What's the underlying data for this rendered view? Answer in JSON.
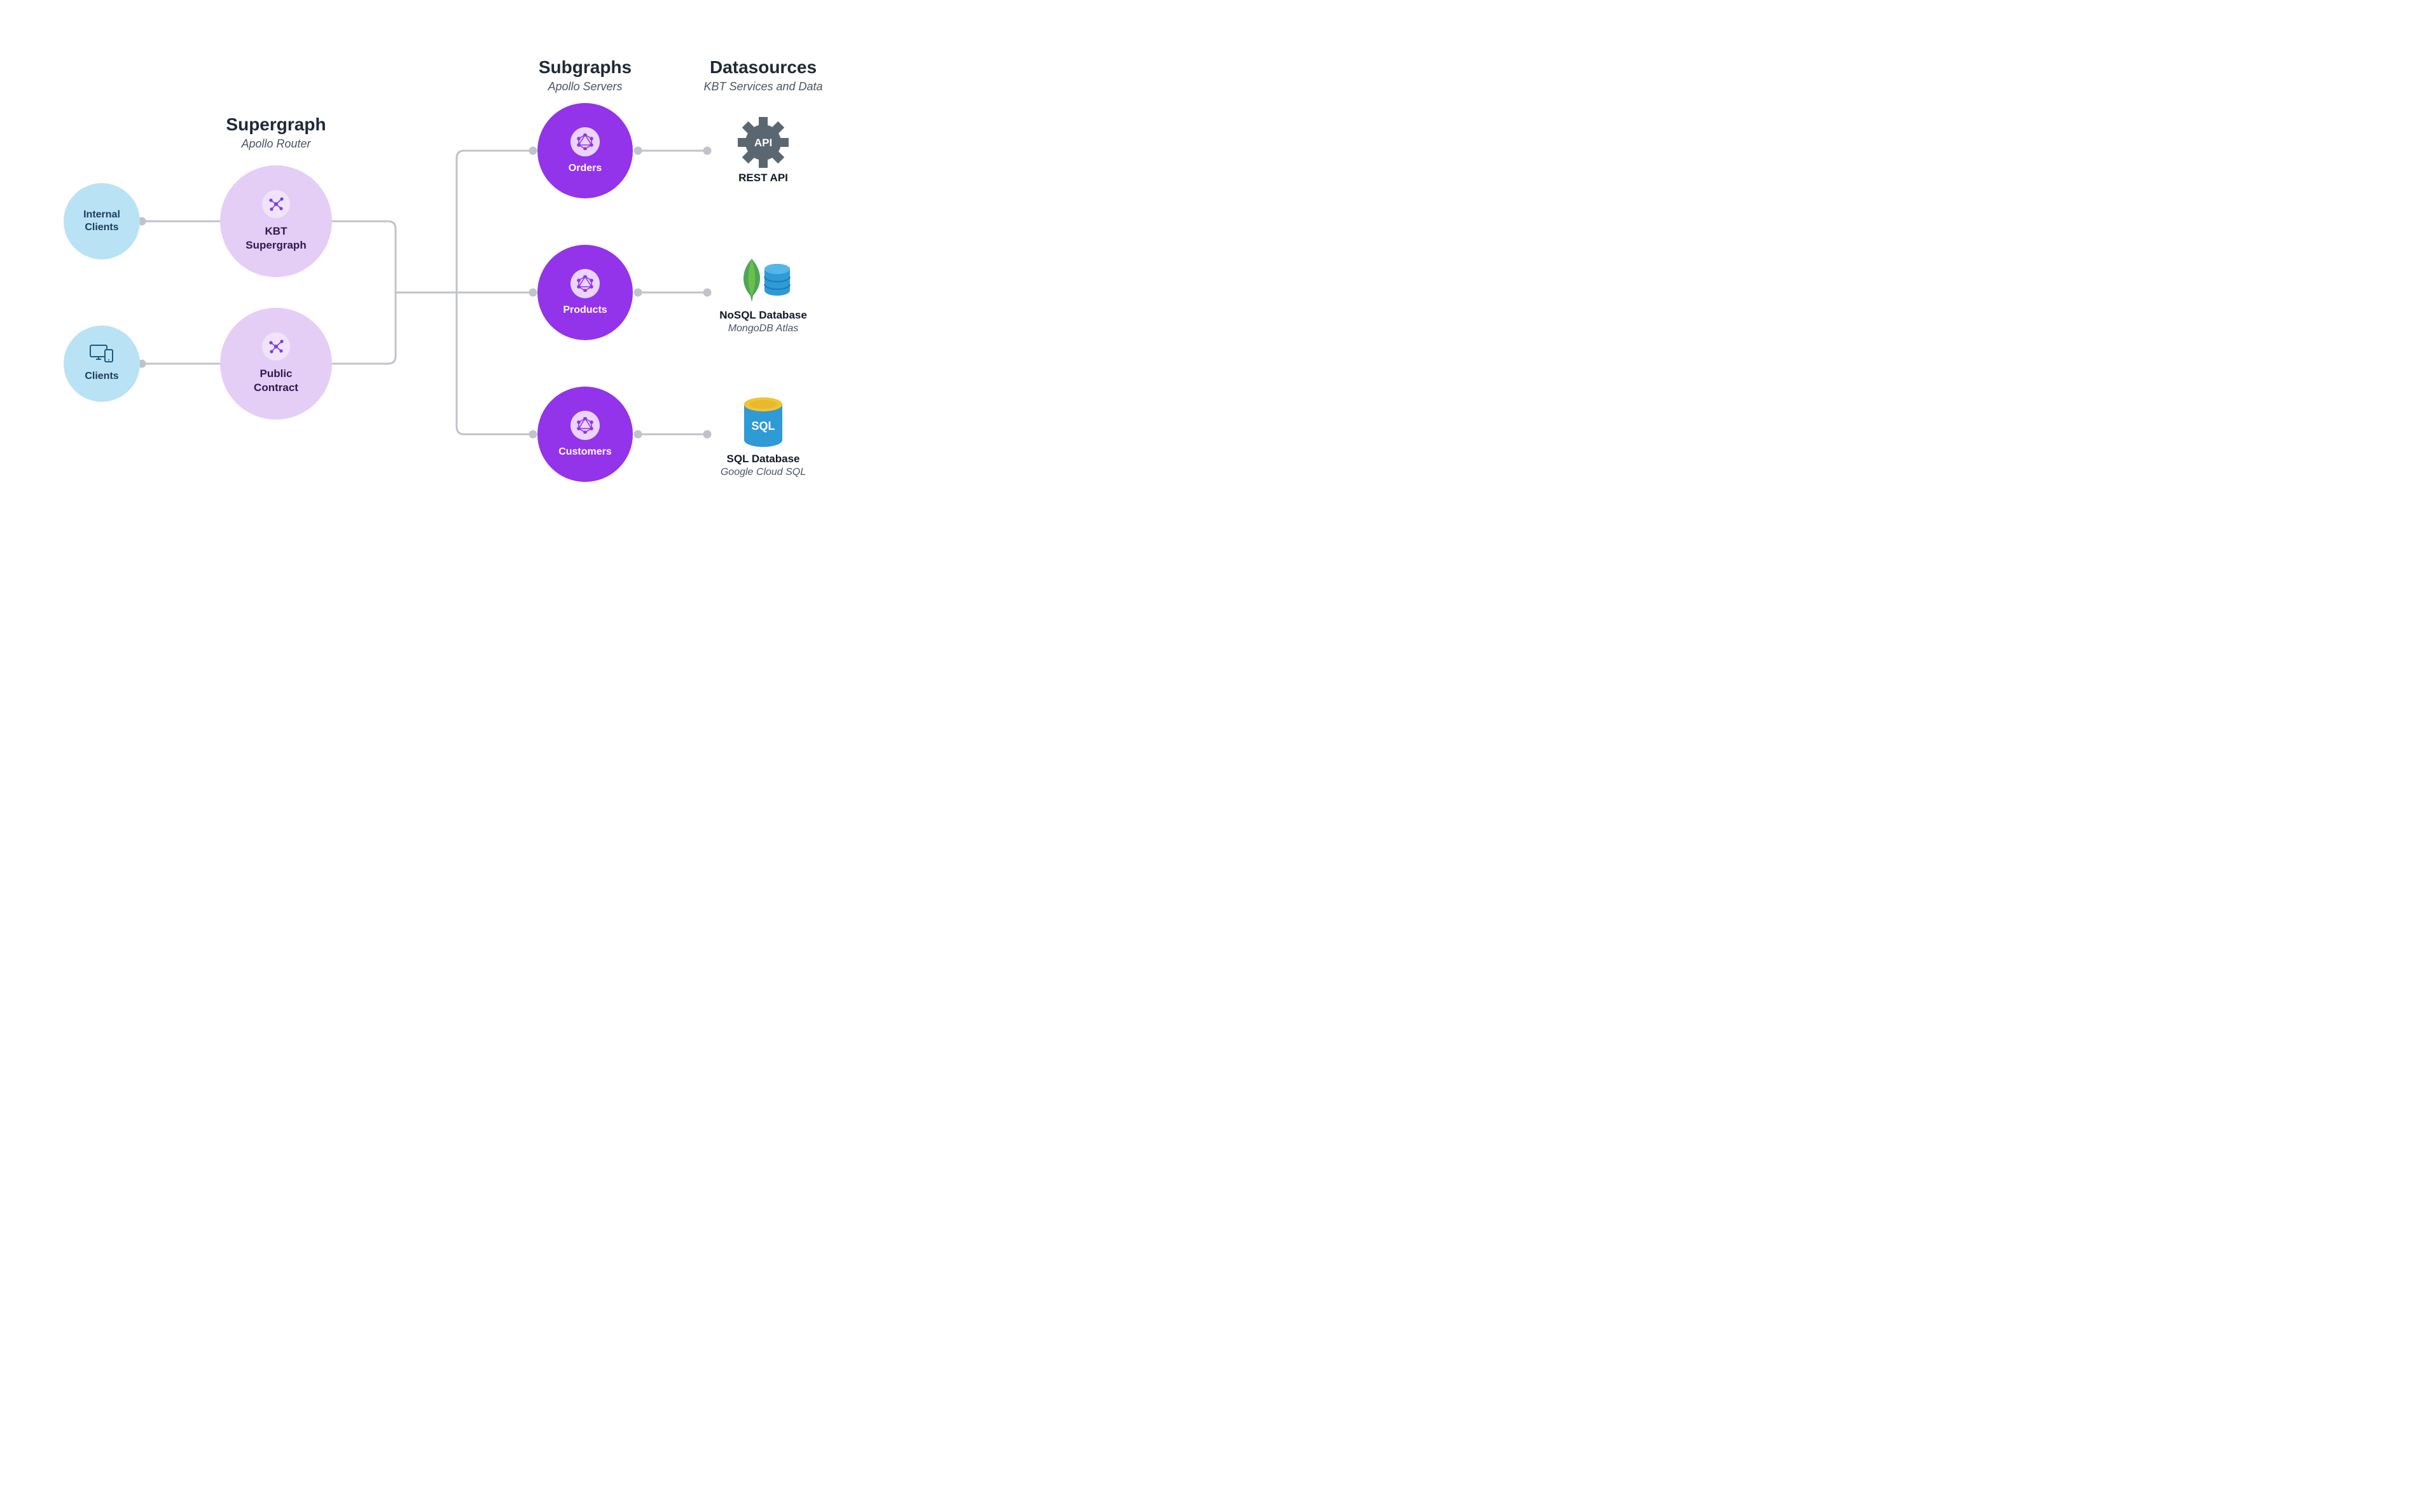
{
  "columns": {
    "supergraph": {
      "title": "Supergraph",
      "subtitle": "Apollo Router"
    },
    "subgraphs": {
      "title": "Subgraphs",
      "subtitle": "Apollo Servers"
    },
    "datasources": {
      "title": "Datasources",
      "subtitle": "KBT Services and Data"
    }
  },
  "clients": {
    "internal": {
      "label": "Internal\nClients"
    },
    "public": {
      "label": "Clients"
    }
  },
  "supergraphs": {
    "kbt": {
      "label": "KBT\nSupergraph"
    },
    "public": {
      "label": "Public\nContract"
    }
  },
  "subgraphs": {
    "orders": {
      "label": "Orders"
    },
    "products": {
      "label": "Products"
    },
    "customers": {
      "label": "Customers"
    }
  },
  "datasources": {
    "rest": {
      "title": "REST API",
      "icon_text": "API"
    },
    "nosql": {
      "title": "NoSQL Database",
      "subtitle": "MongoDB Atlas"
    },
    "sql": {
      "title": "SQL Database",
      "subtitle": "Google Cloud SQL",
      "icon_text": "SQL"
    }
  }
}
